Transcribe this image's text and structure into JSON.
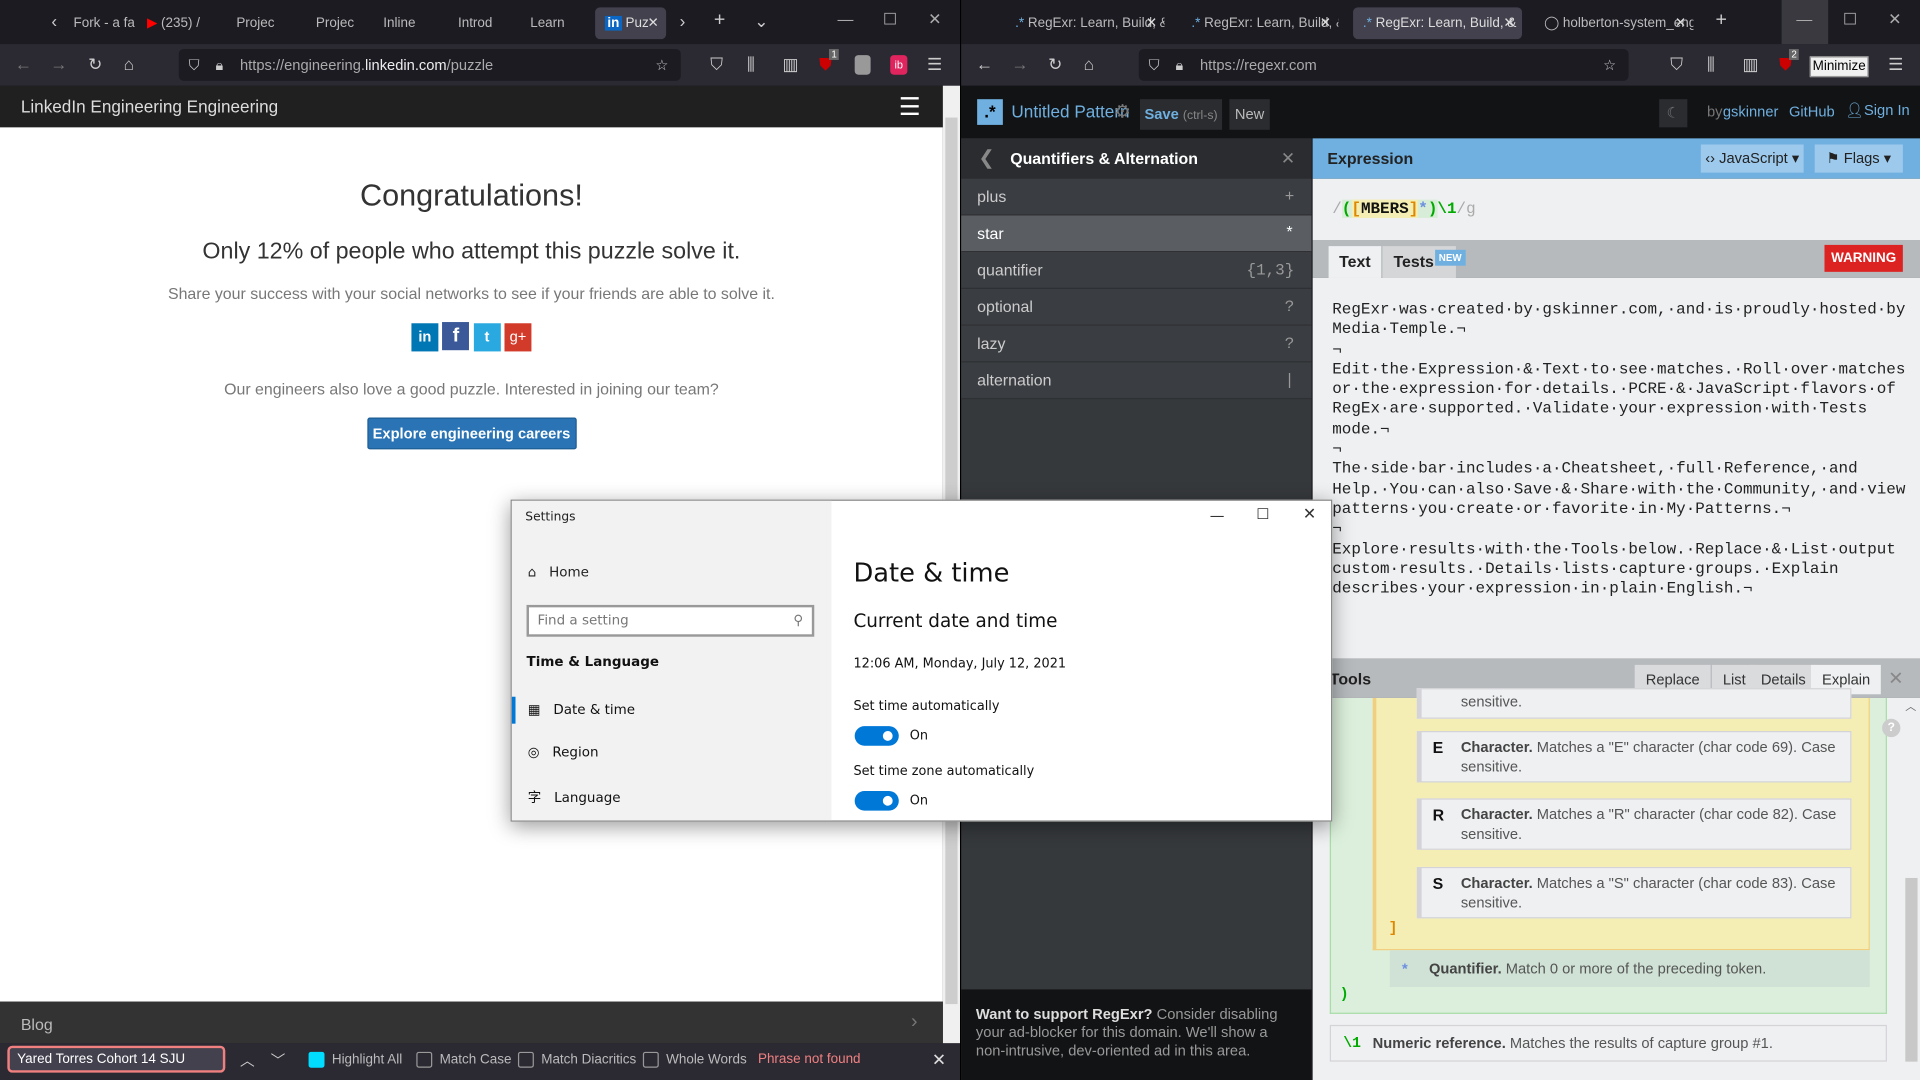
{
  "left_browser": {
    "tabs": [
      "Fork - a fa",
      "(235) /",
      "Projec",
      "Projec",
      "Inline",
      "Introd",
      "Learn",
      "Puz"
    ],
    "url_prefix": "https://engineering.",
    "url_domain": "linkedin.com",
    "url_path": "/puzzle",
    "ext_badge": "1",
    "site_title": "LinkedIn Engineering Engineering",
    "heading": "Congratulations!",
    "subheading": "Only 12% of people who attempt this puzzle solve it.",
    "share_text": "Share your success with your social networks to see if your friends are able to solve it.",
    "social": [
      "in",
      "f",
      "t",
      "g+"
    ],
    "join_text": "Our engineers also love a good puzzle. Interested in joining our team?",
    "cta": "Explore engineering careers",
    "footer_link": "Blog",
    "find": {
      "value": "Yared Torres Cohort 14 SJU",
      "highlight_all": "Highlight All",
      "match_case": "Match Case",
      "match_diacritics": "Match Diacritics",
      "whole_words": "Whole Words",
      "status": "Phrase not found"
    }
  },
  "right_browser": {
    "tabs": [
      "RegExr: Learn, Build, &",
      "RegExr: Learn, Build, &",
      "RegExr: Learn, Build, &",
      "holberton-system_eng"
    ],
    "url": "https://regexr.com",
    "ext_badge": "2",
    "tooltip": "Minimize",
    "header": {
      "title": "Untitled Pattern",
      "save": "Save",
      "save_hint": "(ctrl-s)",
      "new": "New",
      "by": "by",
      "author": "gskinner",
      "github": "GitHub",
      "signin": "Sign In"
    },
    "sidebar": {
      "title": "Quantifiers & Alternation",
      "items": [
        {
          "label": "plus",
          "token": "+"
        },
        {
          "label": "star",
          "token": "*"
        },
        {
          "label": "quantifier",
          "token": "{1,3}"
        },
        {
          "label": "optional",
          "token": "?"
        },
        {
          "label": "lazy",
          "token": "?"
        },
        {
          "label": "alternation",
          "token": "|"
        }
      ],
      "ad_bold": "Want to support RegExr?",
      "ad_text": "Consider disabling your ad-blocker for this domain. We'll show a non-intrusive, dev-oriented ad in this area."
    },
    "expression": {
      "label": "Expression",
      "flavor": "JavaScript",
      "flags": "Flags",
      "open": "/",
      "group_open": "(",
      "set_open": "[",
      "set": "MBERS",
      "set_close": "]",
      "quant": "*",
      "group_close": ")",
      "backref": "\\1",
      "close": "/",
      "flag": "g"
    },
    "text_tabs": {
      "text": "Text",
      "tests": "Tests",
      "new_badge": "NEW",
      "warning": "WARNING"
    },
    "text_lines": [
      "RegExr·was·created·by·gskinner.com,·and·is·proudly·hosted·by",
      "Media·Temple.¬",
      "¬",
      "Edit·the·Expression·&·Text·to·see·matches.·Roll·over·matches",
      "or·the·expression·for·details.·PCRE·&·JavaScript·flavors·of",
      "RegEx·are·supported.·Validate·your·expression·with·Tests",
      "mode.¬",
      "¬",
      "The·side·bar·includes·a·Cheatsheet,·full·Reference,·and",
      "Help.·You·can·also·Save·&·Share·with·the·Community,·and·view",
      "patterns·you·create·or·favorite·in·My·Patterns.¬",
      "¬",
      "Explore·results·with·the·Tools·below.·Replace·&·List·output",
      "custom·results.·Details·lists·capture·groups.·Explain",
      "describes·your·expression·in·plain·English.¬"
    ],
    "tools": {
      "label": "Tools",
      "tabs": [
        "Replace",
        "List",
        "Details",
        "Explain"
      ],
      "partial": "sensitive.",
      "chars": [
        {
          "k": "E",
          "title": "Character.",
          "desc": "Matches a \"E\" character (char code 69). Case sensitive."
        },
        {
          "k": "R",
          "title": "Character.",
          "desc": "Matches a \"R\" character (char code 82). Case sensitive."
        },
        {
          "k": "S",
          "title": "Character.",
          "desc": "Matches a \"S\" character (char code 83). Case sensitive."
        }
      ],
      "set_close": "]",
      "quant": {
        "k": "*",
        "title": "Quantifier.",
        "desc": "Match 0 or more of the preceding token."
      },
      "group_close": ")",
      "backref": {
        "k": "\\1",
        "title": "Numeric reference.",
        "desc": "Matches the results of capture group #1."
      }
    }
  },
  "settings": {
    "title": "Settings",
    "home": "Home",
    "search_placeholder": "Find a setting",
    "section": "Time & Language",
    "nav": [
      "Date & time",
      "Region",
      "Language"
    ],
    "page_title": "Date & time",
    "sub": "Current date and time",
    "datetime": "12:06 AM, Monday, July 12, 2021",
    "set_time_auto": "Set time automatically",
    "set_tz_auto": "Set time zone automatically",
    "on": "On"
  }
}
